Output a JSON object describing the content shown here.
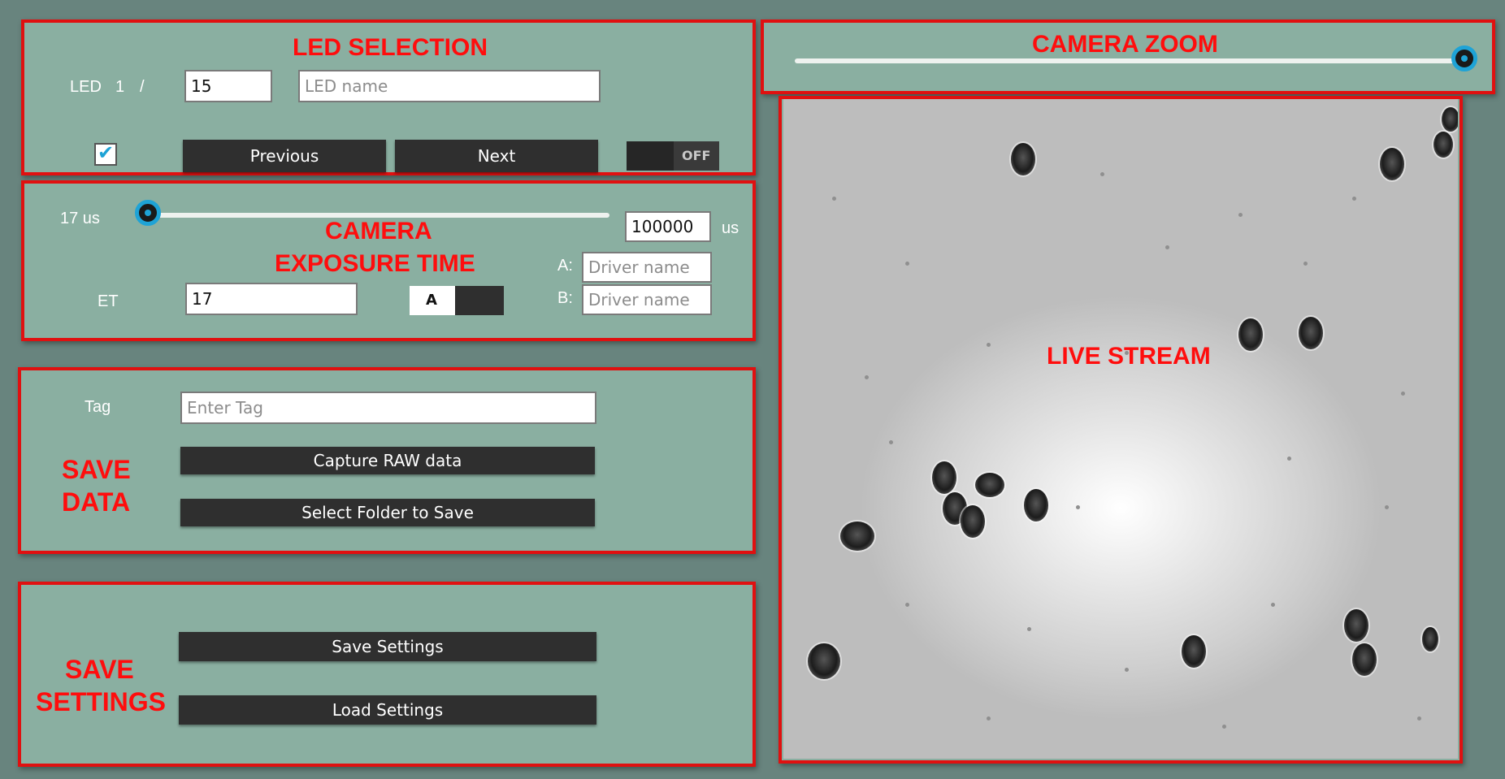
{
  "led_panel": {
    "title": "LED SELECTION",
    "led_label": "LED",
    "led_index": "1",
    "slash": "/",
    "led_count_value": "15",
    "led_name_placeholder": "LED name",
    "previous_label": "Previous",
    "next_label": "Next",
    "toggle_label": "OFF",
    "checkbox_checked": true
  },
  "exposure_panel": {
    "title_line1": "CAMERA",
    "title_line2": "EXPOSURE TIME",
    "min_label": "17 us",
    "max_value": "100000",
    "max_unit": "us",
    "et_label": "ET",
    "et_value": "17",
    "ab_toggle_label": "A",
    "driver_a_label": "A:",
    "driver_b_label": "B:",
    "driver_placeholder": "Driver name"
  },
  "save_data_panel": {
    "title_line1": "SAVE",
    "title_line2": "DATA",
    "tag_label": "Tag",
    "tag_placeholder": "Enter Tag",
    "capture_label": "Capture RAW data",
    "select_folder_label": "Select Folder to Save"
  },
  "save_settings_panel": {
    "title_line1": "SAVE",
    "title_line2": "SETTINGS",
    "save_label": "Save Settings",
    "load_label": "Load Settings"
  },
  "zoom_panel": {
    "title": "CAMERA ZOOM",
    "zoom_level": 1.0
  },
  "stream_panel": {
    "title": "LIVE STREAM"
  },
  "colors": {
    "background": "#68847e",
    "panel": "#8aafa1",
    "border": "#e01010",
    "title_red": "#ff0d0d",
    "accent": "#1ea3d6",
    "button": "#2f2f2f"
  }
}
